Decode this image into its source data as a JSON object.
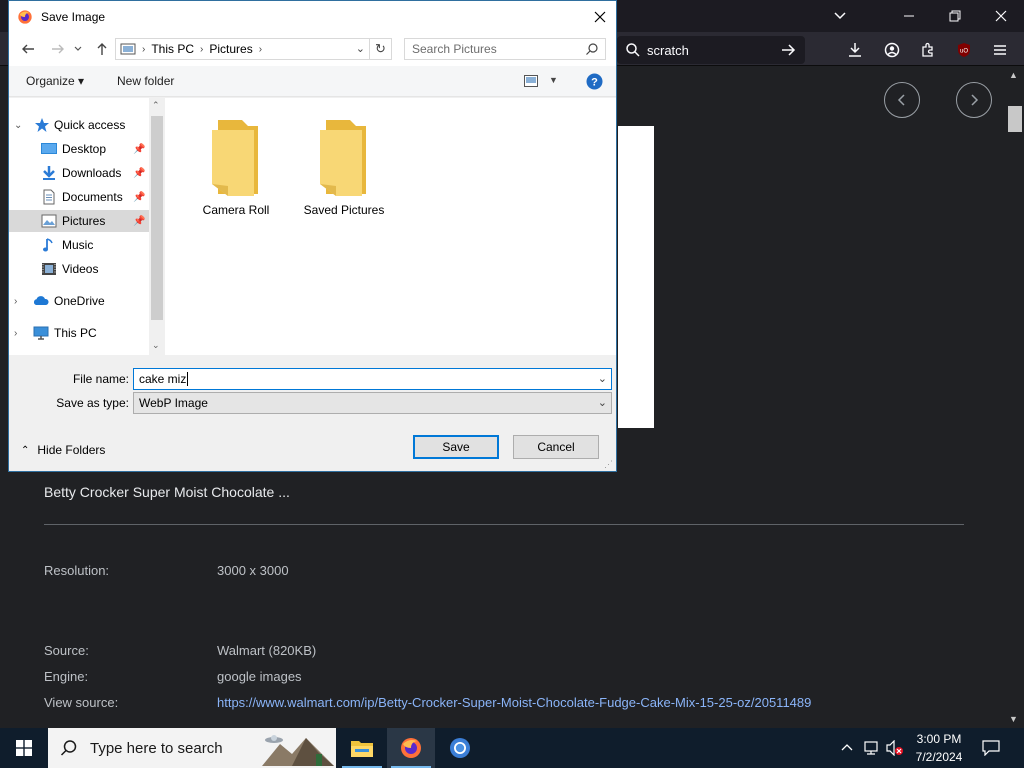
{
  "browser": {
    "url_text": "scratch",
    "image_title": "Betty Crocker Super Moist Chocolate ...",
    "meta": [
      {
        "label": "Resolution:",
        "value": "3000 x 3000"
      },
      {
        "label": "Source:",
        "value": "Walmart (820KB)"
      },
      {
        "label": "Engine:",
        "value": "google images"
      },
      {
        "label": "View source:",
        "value": "https://www.walmart.com/ip/Betty-Crocker-Super-Moist-Chocolate-Fudge-Cake-Mix-15-25-oz/20511489"
      }
    ]
  },
  "dialog": {
    "title": "Save Image",
    "breadcrumb": [
      "This PC",
      "Pictures"
    ],
    "search_placeholder": "Search Pictures",
    "organize_label": "Organize ▾",
    "new_folder_label": "New folder",
    "nav_items": [
      {
        "label": "Quick access",
        "icon": "star-icon"
      },
      {
        "label": "Desktop",
        "icon": "desktop-icon"
      },
      {
        "label": "Downloads",
        "icon": "download-icon"
      },
      {
        "label": "Documents",
        "icon": "document-icon"
      },
      {
        "label": "Pictures",
        "icon": "pictures-icon"
      },
      {
        "label": "Music",
        "icon": "music-icon"
      },
      {
        "label": "Videos",
        "icon": "video-icon"
      },
      {
        "label": "OneDrive",
        "icon": "cloud-icon"
      },
      {
        "label": "This PC",
        "icon": "computer-icon"
      }
    ],
    "folders": [
      "Camera Roll",
      "Saved Pictures"
    ],
    "file_name_label": "File name:",
    "file_name_value": "cake miz",
    "save_type_label": "Save as type:",
    "save_type_value": "WebP Image",
    "hide_folders_label": "Hide Folders",
    "save_label": "Save",
    "cancel_label": "Cancel"
  },
  "taskbar": {
    "search_placeholder": "Type here to search",
    "time": "3:00 PM",
    "date": "7/2/2024"
  },
  "colors": {
    "accent": "#0078d7",
    "browser_bg": "#202124",
    "taskbar_bg": "#0f1d2c",
    "link": "#8ab4f8"
  }
}
